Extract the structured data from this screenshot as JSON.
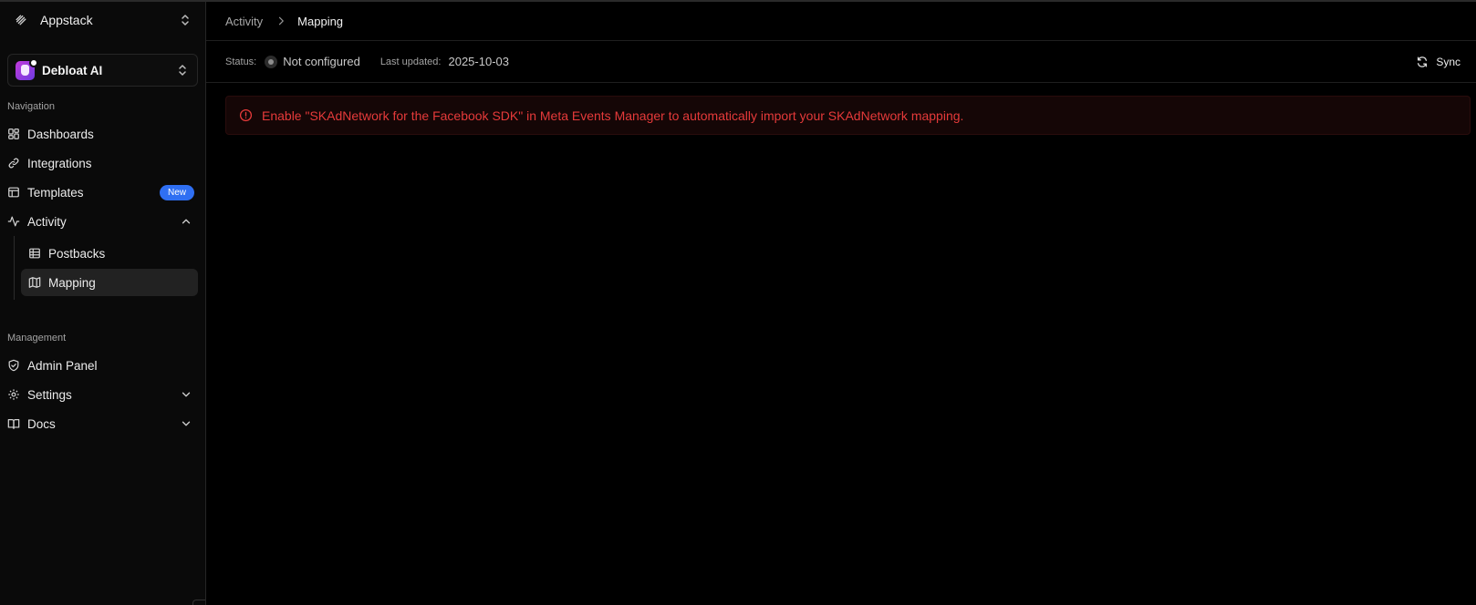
{
  "sidebar": {
    "org": {
      "name": "Appstack"
    },
    "app": {
      "name": "Debloat AI"
    },
    "sections": {
      "navigation": "Navigation",
      "management": "Management"
    },
    "nav": {
      "dashboards": "Dashboards",
      "integrations": "Integrations",
      "templates": "Templates",
      "templates_badge": "New",
      "activity": "Activity",
      "postbacks": "Postbacks",
      "mapping": "Mapping"
    },
    "management": {
      "admin_panel": "Admin Panel",
      "settings": "Settings",
      "docs": "Docs"
    }
  },
  "breadcrumb": {
    "parent": "Activity",
    "current": "Mapping"
  },
  "status_bar": {
    "status_label": "Status:",
    "status_value": "Not configured",
    "updated_label": "Last updated:",
    "updated_value": "2025-10-03",
    "sync_label": "Sync"
  },
  "alert": {
    "message": "Enable \"SKAdNetwork for the Facebook SDK\" in Meta Events Manager to automatically import your SKAdNetwork mapping."
  },
  "colors": {
    "accent": "#2f6ff2",
    "error": "#e53a3a",
    "background": "#000000"
  }
}
